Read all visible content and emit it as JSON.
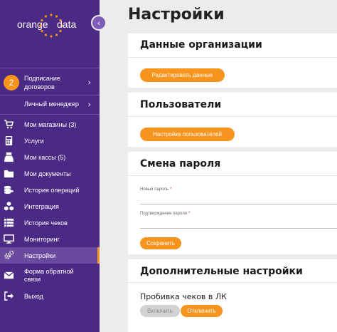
{
  "brand": {
    "left": "orange",
    "right": "data",
    "accent": "#f7941d",
    "sidebar_bg": "#4b2a86"
  },
  "sidebar": {
    "collapse_icon": "chevron-left-icon",
    "contracts": {
      "badge": "2",
      "label": "Подписание договоров"
    },
    "manager": {
      "label": "Личный менеджер"
    },
    "items": [
      {
        "label": "Мои магазины (3)",
        "icon": "cart-icon"
      },
      {
        "label": "Услуги",
        "icon": "calculator-icon"
      },
      {
        "label": "Мои кассы (5)",
        "icon": "cash-register-icon"
      },
      {
        "label": "Мои документы",
        "icon": "folder-icon"
      },
      {
        "label": "История операций",
        "icon": "coins-icon"
      },
      {
        "label": "Интеграция",
        "icon": "cubes-icon"
      },
      {
        "label": "История чеков",
        "icon": "list-icon"
      },
      {
        "label": "Мониторинг",
        "icon": "monitor-icon"
      },
      {
        "label": "Настройки",
        "icon": "gears-icon",
        "active": true
      },
      {
        "label": "Форма обратной связи",
        "icon": "envelope-icon"
      },
      {
        "label": "Выход",
        "icon": "sign-out-icon"
      }
    ]
  },
  "main": {
    "title": "Настройки",
    "org": {
      "title": "Данные организации",
      "edit_button": "Редактировать данные"
    },
    "users": {
      "title": "Пользователи",
      "settings_button": "Настройка пользователей"
    },
    "password": {
      "title": "Смена пароля",
      "new_label": "Новый пароль",
      "confirm_label": "Подтверждение пароля",
      "required_mark": "*",
      "new_value": "",
      "confirm_value": "",
      "save_button": "Сохранить"
    },
    "extra": {
      "title": "Дополнительные настройки",
      "check_label": "Пробивка чеков в ЛК",
      "enable_button": "Включить",
      "disable_button": "Отключить"
    }
  }
}
